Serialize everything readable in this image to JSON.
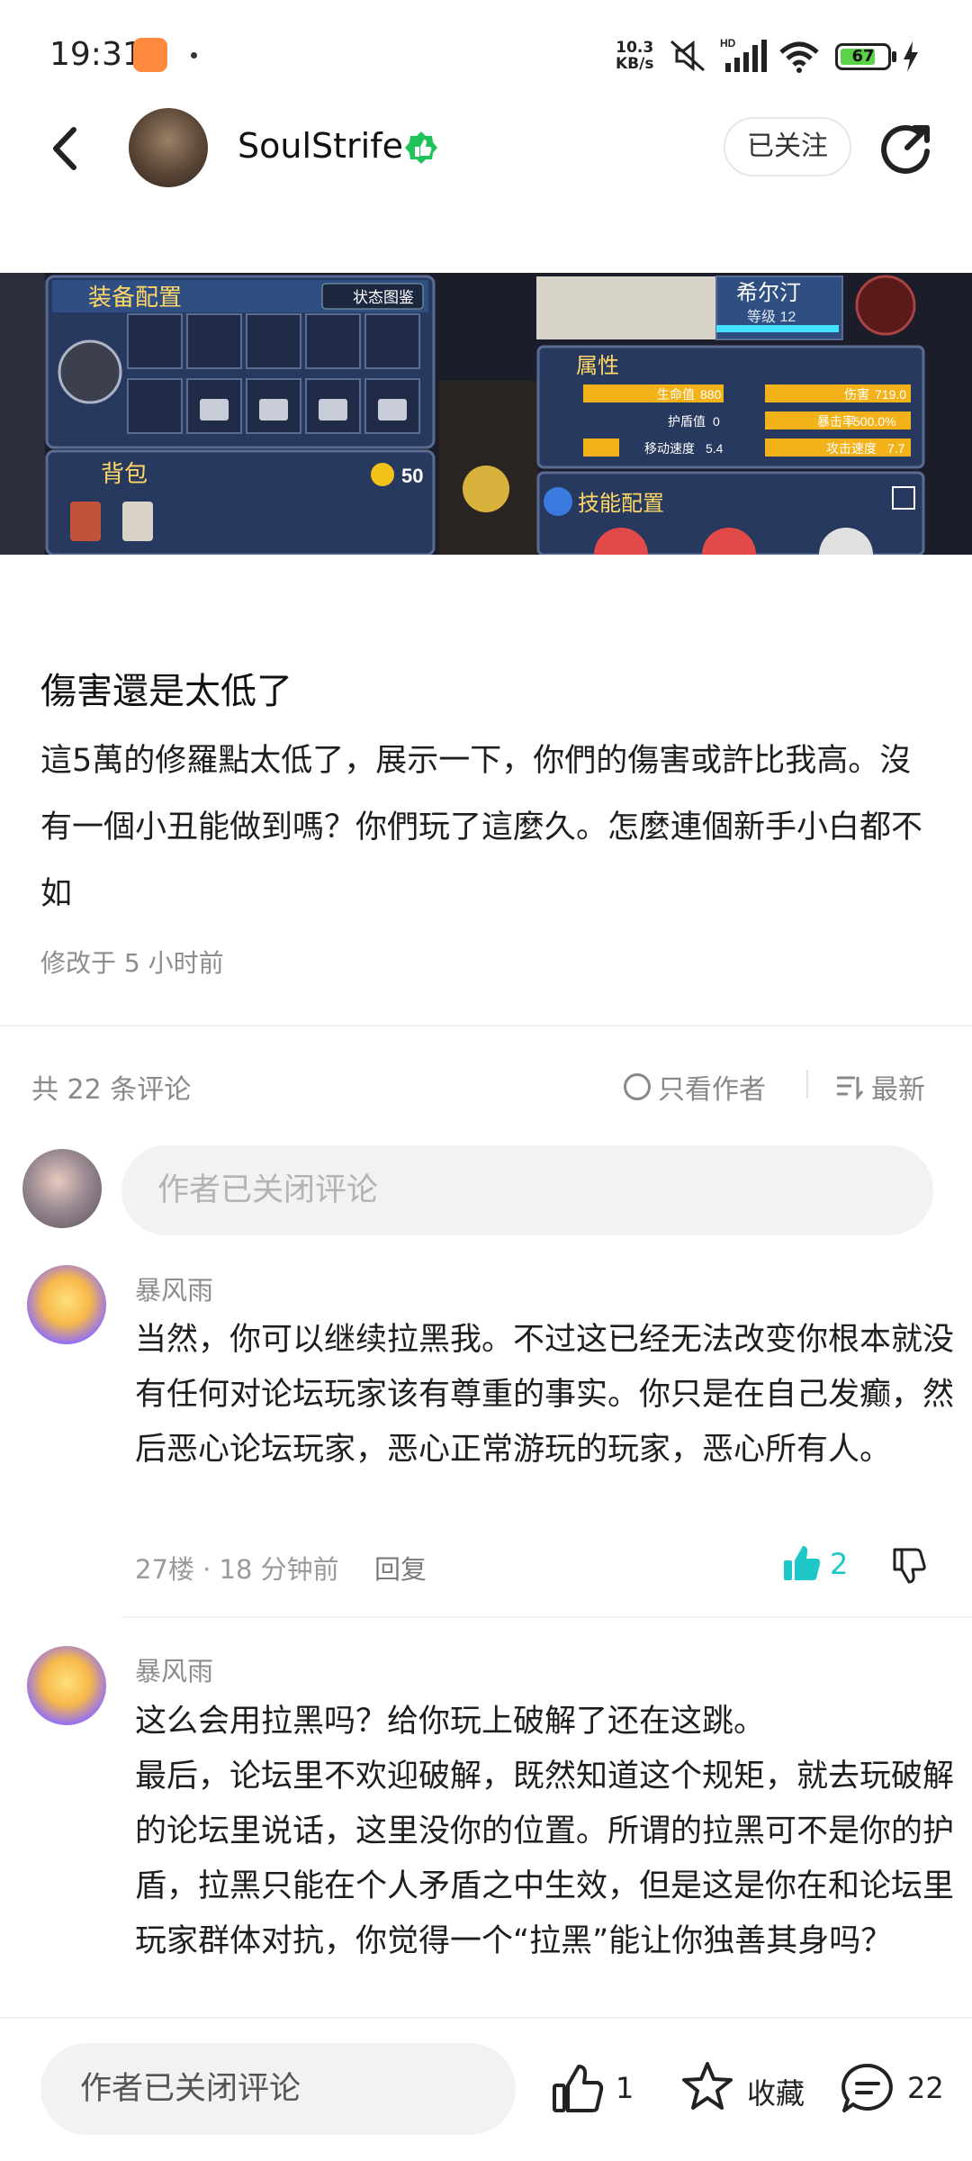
{
  "status_bar": {
    "time": "19:31",
    "net_speed_value": "10.3",
    "net_speed_unit": "KB/s",
    "battery": "67"
  },
  "header": {
    "author": "SoulStrife",
    "follow_label": "已关注"
  },
  "game_image": {
    "panel_equip": "装备配置",
    "status_tab": "状态图鉴",
    "bag": "背包",
    "coins": "50",
    "hero_name": "希尔汀",
    "level": "等级 12",
    "attributes_title": "属性",
    "stats": {
      "hp_label": "生命值",
      "hp": "880",
      "damage_label": "伤害",
      "damage": "719.0",
      "armor_label": "护盾值",
      "armor": "0",
      "crit_label": "暴击率",
      "crit": "500.0%",
      "move_label": "移动速度",
      "move": "5.4",
      "atkspeed_label": "攻击速度",
      "atkspeed": "7.7"
    },
    "skills_title": "技能配置"
  },
  "post": {
    "title": "傷害還是太低了",
    "body": "這5萬的修羅點太低了，展示一下，你們的傷害或許比我高。沒有一個小丑能做到嗎？你們玩了這麼久。怎麼連個新手小白都不如",
    "meta": "修改于 5 小时前"
  },
  "comments_header": {
    "count": "共 22 条评论",
    "author_only": "只看作者",
    "sort": "最新"
  },
  "comment_input_placeholder": "作者已关闭评论",
  "comments": [
    {
      "name": "暴风雨",
      "text": "当然，你可以继续拉黑我。不过这已经无法改变你根本就没有任何对论坛玩家该有尊重的事实。你只是在自己发癫，然后恶心论坛玩家，恶心正常游玩的玩家，恶心所有人。",
      "meta": "27楼 · 18 分钟前",
      "reply": "回复",
      "likes": "2"
    },
    {
      "name": "暴风雨",
      "text": "这么会用拉黑吗？给你玩上破解了还在这跳。\n最后，论坛里不欢迎破解，既然知道这个规矩，就去玩破解的论坛里说话，这里没你的位置。所谓的拉黑可不是你的护盾，拉黑只能在个人矛盾之中生效，但是这是你在和论坛里玩家群体对抗，你觉得一个“拉黑”能让你独善其身吗？"
    }
  ],
  "bottom_bar": {
    "input_placeholder": "作者已关闭评论",
    "like_count": "1",
    "favorite_label": "收藏",
    "comment_count": "22"
  },
  "colors": {
    "accent": "#1ec8c8",
    "verify_green": "#1fc35a",
    "hp_bar": "#f3b21a"
  }
}
